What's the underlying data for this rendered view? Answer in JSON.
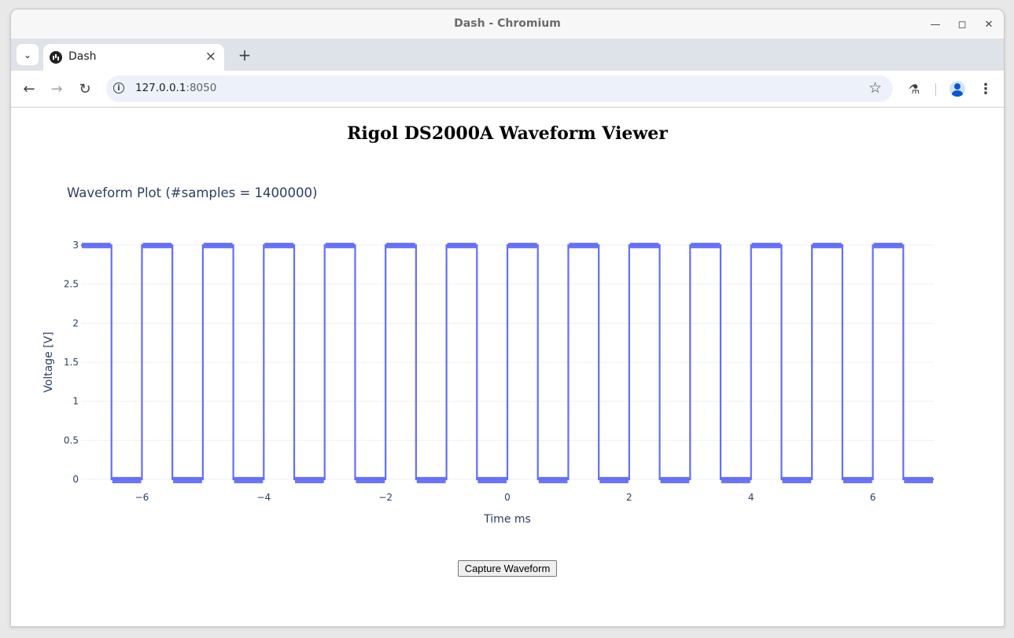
{
  "window": {
    "title": "Dash - Chromium"
  },
  "tabs": [
    {
      "label": "Dash"
    }
  ],
  "address_bar": {
    "host": "127.0.0.1",
    "port": ":8050"
  },
  "page": {
    "title": "Rigol DS2000A Waveform Viewer",
    "capture_button_label": "Capture Waveform"
  },
  "chart_data": {
    "type": "line",
    "title": "Waveform Plot (#samples = 1400000)",
    "xlabel": "Time ms",
    "ylabel": "Voltage [V]",
    "xlim": [
      -7,
      7
    ],
    "ylim": [
      -0.05,
      3.05
    ],
    "x_ticks": [
      -6,
      -4,
      -2,
      0,
      2,
      4,
      6
    ],
    "x_tick_labels": [
      "−6",
      "−4",
      "−2",
      "0",
      "2",
      "4",
      "6"
    ],
    "y_ticks": [
      0,
      0.5,
      1,
      1.5,
      2,
      2.5,
      3
    ],
    "y_tick_labels": [
      "0",
      "0.5",
      "1",
      "1.5",
      "2",
      "2.5",
      "3"
    ],
    "grid": true,
    "series": [
      {
        "color": "#636efa",
        "x": [
          -7.0,
          -6.5,
          -6.5,
          -6.0,
          -6.0,
          -5.5,
          -5.5,
          -5.0,
          -5.0,
          -4.5,
          -4.5,
          -4.0,
          -4.0,
          -3.5,
          -3.5,
          -3.0,
          -3.0,
          -2.5,
          -2.5,
          -2.0,
          -2.0,
          -1.5,
          -1.5,
          -1.0,
          -1.0,
          -0.5,
          -0.5,
          0.0,
          0.0,
          0.5,
          0.5,
          1.0,
          1.0,
          1.5,
          1.5,
          2.0,
          2.0,
          2.5,
          2.5,
          3.0,
          3.0,
          3.5,
          3.5,
          4.0,
          4.0,
          4.5,
          4.5,
          5.0,
          5.0,
          5.5,
          5.5,
          6.0,
          6.0,
          6.5,
          6.5,
          7.0
        ],
        "y": [
          3,
          3,
          0,
          0,
          3,
          3,
          0,
          0,
          3,
          3,
          0,
          0,
          3,
          3,
          0,
          0,
          3,
          3,
          0,
          0,
          3,
          3,
          0,
          0,
          3,
          3,
          0,
          0,
          3,
          3,
          0,
          0,
          3,
          3,
          0,
          0,
          3,
          3,
          0,
          0,
          3,
          3,
          0,
          0,
          3,
          3,
          0,
          0,
          3,
          3,
          0,
          0,
          3,
          3,
          0,
          0
        ]
      }
    ]
  }
}
